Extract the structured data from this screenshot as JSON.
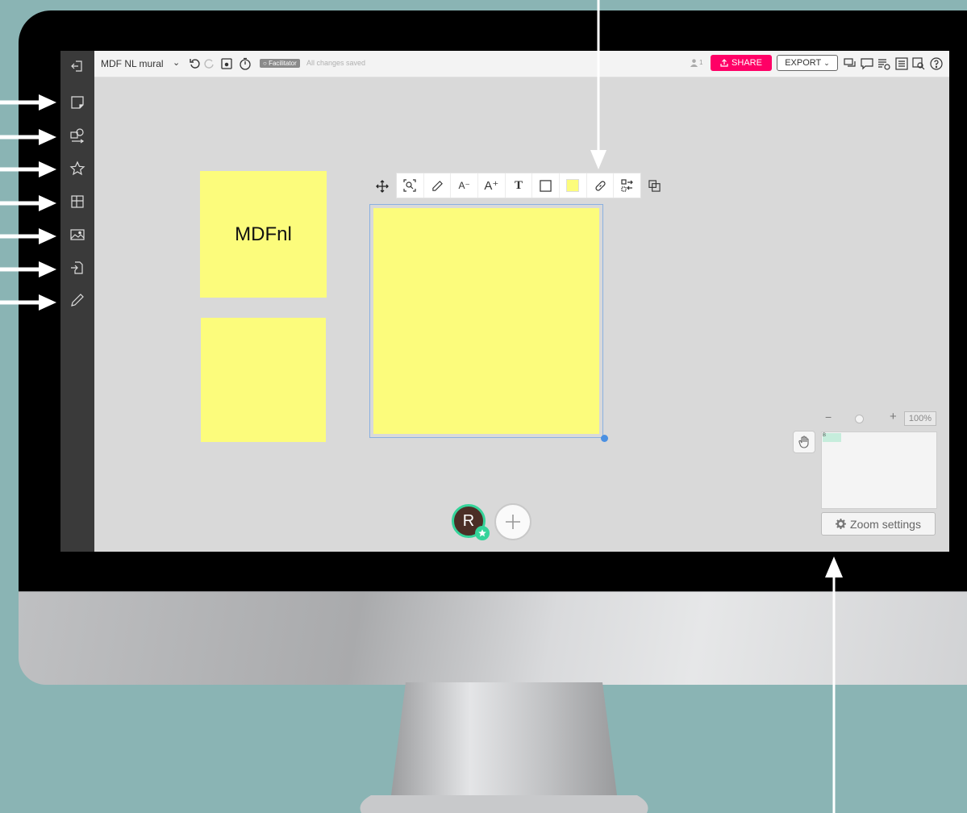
{
  "colors": {
    "background": "#8ab4b4",
    "share_accent": "#ff0066",
    "sticky_yellow": "#fcfc7c",
    "avatar_ring": "#35d39a",
    "selection_blue": "#4a90e2"
  },
  "left_toolbar": {
    "items": [
      {
        "name": "exit-mural-icon"
      },
      {
        "name": "sticky-note-icon"
      },
      {
        "name": "shapes-connectors-icon"
      },
      {
        "name": "icons-star-icon"
      },
      {
        "name": "frameworks-grid-icon"
      },
      {
        "name": "image-icon"
      },
      {
        "name": "file-import-icon"
      },
      {
        "name": "pencil-draw-icon"
      }
    ]
  },
  "topbar": {
    "mural_title": "MDF NL mural",
    "facilitator_badge": "Facilitator",
    "save_status": "All changes saved",
    "user_count": "1",
    "share_label": "SHARE",
    "export_label": "EXPORT"
  },
  "canvas": {
    "sticky_notes": [
      {
        "text": "MDFnl"
      },
      {
        "text": ""
      },
      {
        "text": ""
      }
    ],
    "context_toolbar": {
      "buttons": [
        {
          "name": "zoom-to-fit-icon"
        },
        {
          "name": "draw-pencil-icon"
        },
        {
          "name": "decrease-font-icon",
          "label": "A⁻"
        },
        {
          "name": "increase-font-icon",
          "label": "A⁺"
        },
        {
          "name": "text-format-icon",
          "label": "T"
        },
        {
          "name": "border-icon"
        },
        {
          "name": "color-swatch-icon"
        },
        {
          "name": "link-icon"
        },
        {
          "name": "swap-icon"
        }
      ]
    },
    "avatar_initial": "R"
  },
  "zoom": {
    "level": "100%",
    "settings_label": "Zoom settings",
    "minimap_label": "B"
  }
}
